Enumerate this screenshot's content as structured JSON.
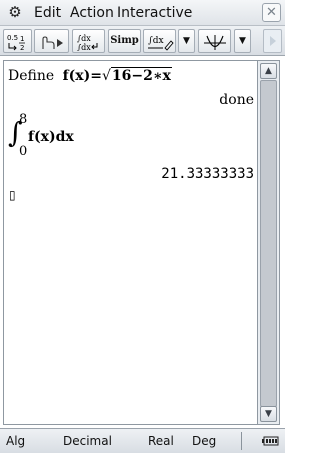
{
  "menubar": {
    "items": [
      {
        "label": "Edit"
      },
      {
        "label": "Action"
      },
      {
        "label": "Interactive"
      }
    ],
    "close": "✕"
  },
  "toolbar": {
    "simp_label": "Simp",
    "dropdown_arrow": "▼"
  },
  "work": {
    "line1": {
      "keyword": "Define",
      "fn": "f(x)=",
      "radicand": "16−2∗x"
    },
    "result1": "done",
    "line2": {
      "upper": "8",
      "lower": "0",
      "integrand": "f(x)dx"
    },
    "result2": "21.33333333",
    "cursor": "▯"
  },
  "scrollbar": {
    "up": "▲",
    "down": "▼"
  },
  "statusbar": {
    "mode": "Alg",
    "format": "Decimal",
    "domain": "Real",
    "angle": "Deg"
  }
}
